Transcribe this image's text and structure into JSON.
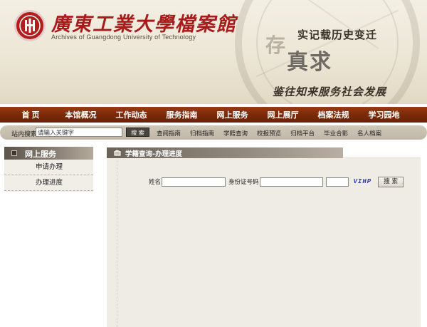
{
  "header": {
    "logo_title": "廣東工業大學檔案館",
    "logo_subtitle": "Archives of Guangdong University of Technology",
    "slogan_top": "实记载历史变迁",
    "slogan_big_1": "存",
    "slogan_big_2": "真求",
    "slogan_bottom": "鉴往知来服务社会发展"
  },
  "nav": {
    "items": [
      "首 页",
      "本馆概况",
      "工作动态",
      "服务指南",
      "网上服务",
      "网上展厅",
      "档案法规",
      "学习园地"
    ]
  },
  "search": {
    "label": "站内搜索:",
    "value": "请输入关键字",
    "button": "搜 索",
    "quicklinks": [
      "查阅指南",
      "归档指南",
      "学籍查询",
      "校报预览",
      "归档平台",
      "毕业合影",
      "名人档案"
    ]
  },
  "sidebar": {
    "title": "网上服务",
    "items": [
      "申请办理",
      "办理进度"
    ]
  },
  "content": {
    "title": "学籍查询-办理进度",
    "form": {
      "name_label": "姓名",
      "id_label": "身份证号码",
      "captcha": "VIHP",
      "submit_label": "搜 索"
    }
  },
  "colors": {
    "nav_bg": "#7a2a0a",
    "logo_red": "#a81b1b",
    "captcha_blue": "#2a3aa8"
  }
}
